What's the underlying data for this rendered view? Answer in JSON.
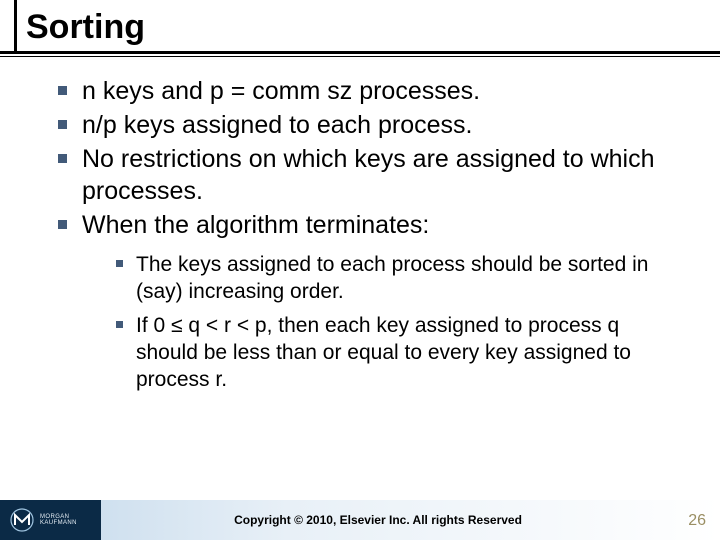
{
  "title": "Sorting",
  "bullets": {
    "b1": "n keys and p = comm sz processes.",
    "b2": "n/p keys assigned to each process.",
    "b3": "No restrictions on which keys are assigned to which processes.",
    "b4": "When the algorithm terminates:",
    "s1": "The keys assigned to each process should be sorted in (say) increasing order.",
    "s2": "If 0 ≤ q < r < p, then each key assigned to process q should be less than or equal to every key assigned to process r."
  },
  "footer": {
    "logo_text": "MORGAN KAUFMANN",
    "copyright": "Copyright © 2010, Elsevier Inc. All rights Reserved"
  },
  "page_number": "26"
}
